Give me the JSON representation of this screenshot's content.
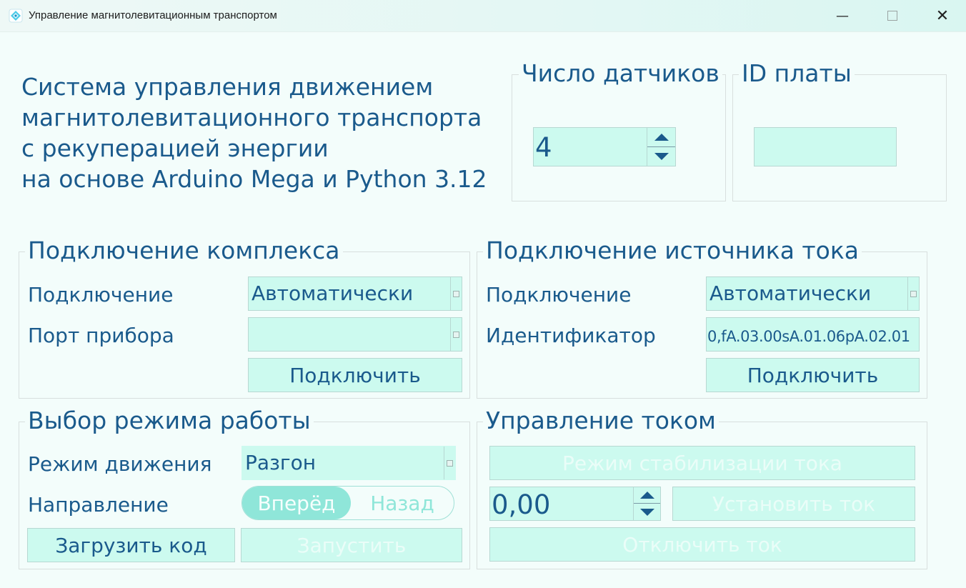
{
  "window": {
    "title": "Управление магнитолевитационным транспортом",
    "minimize": "—",
    "close": "✕"
  },
  "header": {
    "title_lines": [
      "Система управления движением",
      "магнитолевитационного транспорта",
      "с рекуперацией энергии",
      "на основе Arduino Mega и Python 3.12"
    ]
  },
  "sensors": {
    "legend": "Число датчиков",
    "value": "4"
  },
  "board": {
    "legend": "ID платы",
    "value": ""
  },
  "complex": {
    "legend": "Подключение комплекса",
    "connection_label": "Подключение",
    "connection_value": "Автоматически",
    "port_label": "Порт прибора",
    "port_value": "",
    "connect_button": "Подключить"
  },
  "power_source": {
    "legend": "Подключение источника тока",
    "connection_label": "Подключение",
    "connection_value": "Автоматически",
    "id_label": "Идентификатор",
    "id_value": "0,fA.03.00sA.01.06pA.02.01",
    "connect_button": "Подключить"
  },
  "mode": {
    "legend": "Выбор режима работы",
    "motion_label": "Режим движения",
    "motion_value": "Разгон",
    "direction_label": "Направление",
    "direction_options": [
      "Вперёд",
      "Назад"
    ],
    "direction_selected": "Вперёд",
    "load_button": "Загрузить код",
    "run_button": "Запустить"
  },
  "current": {
    "legend": "Управление током",
    "stabilize_button": "Режим стабилизации тока",
    "value": "0,00",
    "set_button": "Установить ток",
    "off_button": "Отключить ток"
  },
  "colors": {
    "accent_text": "#1a5a8c",
    "field_bg": "#ccfaef",
    "window_bg": "#f3fdfb",
    "toggle_active": "#8fe6d9"
  }
}
